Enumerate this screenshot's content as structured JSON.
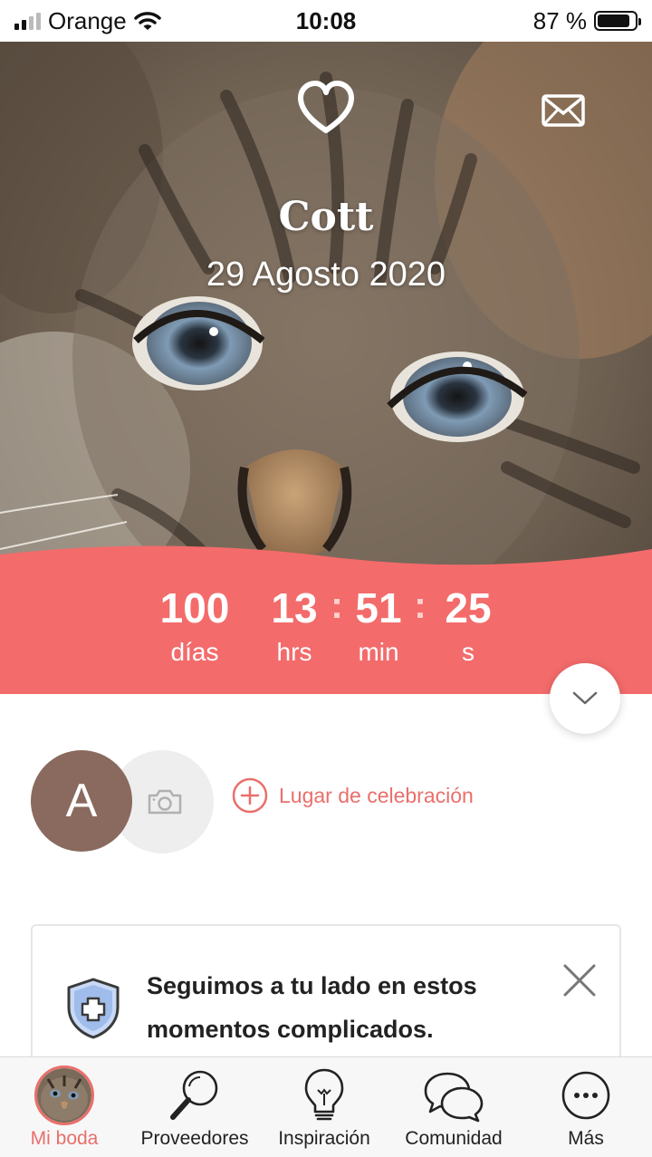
{
  "status_bar": {
    "carrier": "Orange",
    "time": "10:08",
    "battery": "87 %",
    "battery_level": 0.87
  },
  "hero": {
    "name": "Cott",
    "date": "29 Agosto 2020",
    "heart_icon": "heart-outline-icon",
    "mail_icon": "envelope-icon"
  },
  "countdown": {
    "days": "100",
    "days_label": "días",
    "hours": "13",
    "hours_label": "hrs",
    "minutes": "51",
    "minutes_label": "min",
    "seconds": "25",
    "seconds_label": "s",
    "separator": ":"
  },
  "couple": {
    "initial": "A",
    "venue_label": "Lugar de celebración"
  },
  "notice_card": {
    "text": "Seguimos a tu lado en estos momentos complicados."
  },
  "tabbar": {
    "tabs": [
      {
        "label": "Mi boda",
        "icon": "profile-avatar-icon",
        "active": true
      },
      {
        "label": "Proveedores",
        "icon": "magnifier-icon",
        "active": false
      },
      {
        "label": "Inspiración",
        "icon": "lightbulb-icon",
        "active": false
      },
      {
        "label": "Comunidad",
        "icon": "chat-bubbles-icon",
        "active": false
      },
      {
        "label": "Más",
        "icon": "more-dots-icon",
        "active": false
      }
    ]
  },
  "colors": {
    "accent": "#e96f6b",
    "countdown_band": "#f36b6b",
    "avatar_brown": "#8a6a5e"
  }
}
